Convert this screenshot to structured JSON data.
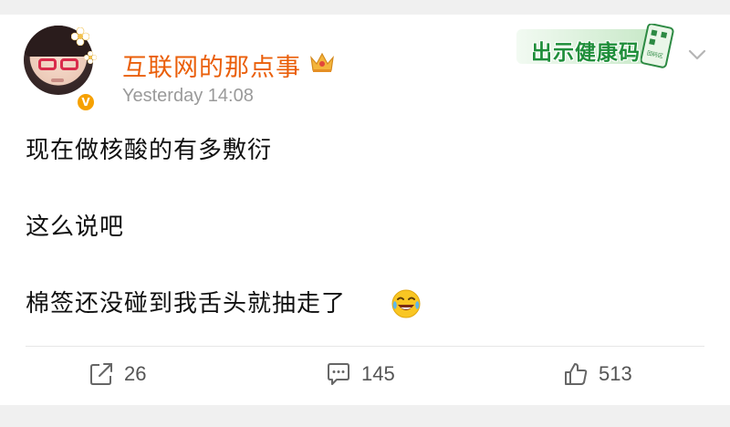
{
  "post": {
    "author": {
      "name": "互联网的那点事",
      "verified_badge": "V",
      "timestamp": "Yesterday 14:08",
      "avatar_icon": "avatar-girl-red-glasses",
      "crown_icon": "crown-icon"
    },
    "sticker": {
      "text": "出示健康码",
      "phone_text": "回码区"
    },
    "body_lines": [
      "现在做核酸的有多敷衍",
      "这么说吧",
      "棉签还没碰到我舌头就抽走了"
    ],
    "emoji": "laugh-cry-emoji",
    "actions": {
      "repost_count": "26",
      "comment_count": "145",
      "like_count": "513"
    }
  },
  "colors": {
    "username": "#ea5f0a",
    "timestamp": "#9a9a9a",
    "sticker_green": "#1f8e3a",
    "badge_orange": "#f6a100"
  }
}
